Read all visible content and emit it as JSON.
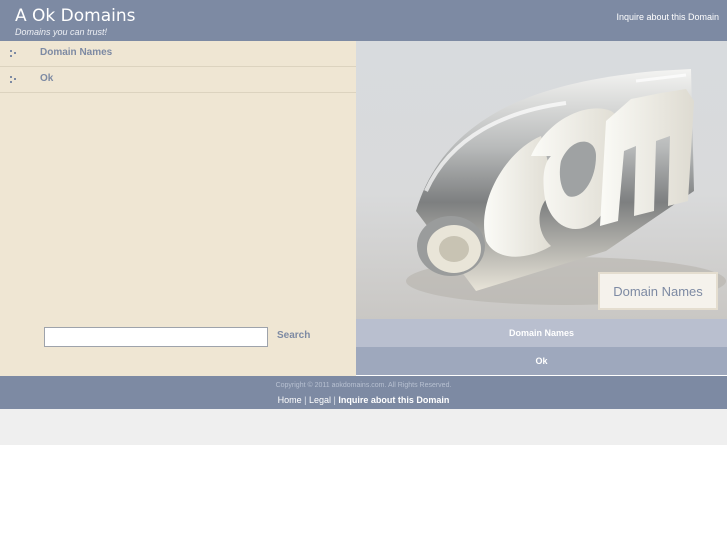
{
  "header": {
    "title": "A Ok Domains",
    "tagline": "Domains you can trust!",
    "inquire_link": "Inquire about this Domain"
  },
  "sidebar": {
    "items": [
      {
        "label": "Domain Names"
      },
      {
        "label": "Ok"
      }
    ]
  },
  "search": {
    "value": "",
    "button_label": "Search"
  },
  "hero": {
    "caption": "Domain Names"
  },
  "right_nav": {
    "items": [
      {
        "label": "Domain Names"
      },
      {
        "label": "Ok"
      }
    ]
  },
  "footer": {
    "copyright": "Copyright © 2011 aokdomains.com. All Rights Reserved.",
    "links": [
      {
        "label": "Home"
      },
      {
        "label": "Legal"
      },
      {
        "label": "Inquire about this Domain"
      }
    ]
  },
  "colors": {
    "header_bg": "#7d8aa3",
    "sidebar_bg": "#efe6d3",
    "accent_text": "#7d8aa3"
  }
}
